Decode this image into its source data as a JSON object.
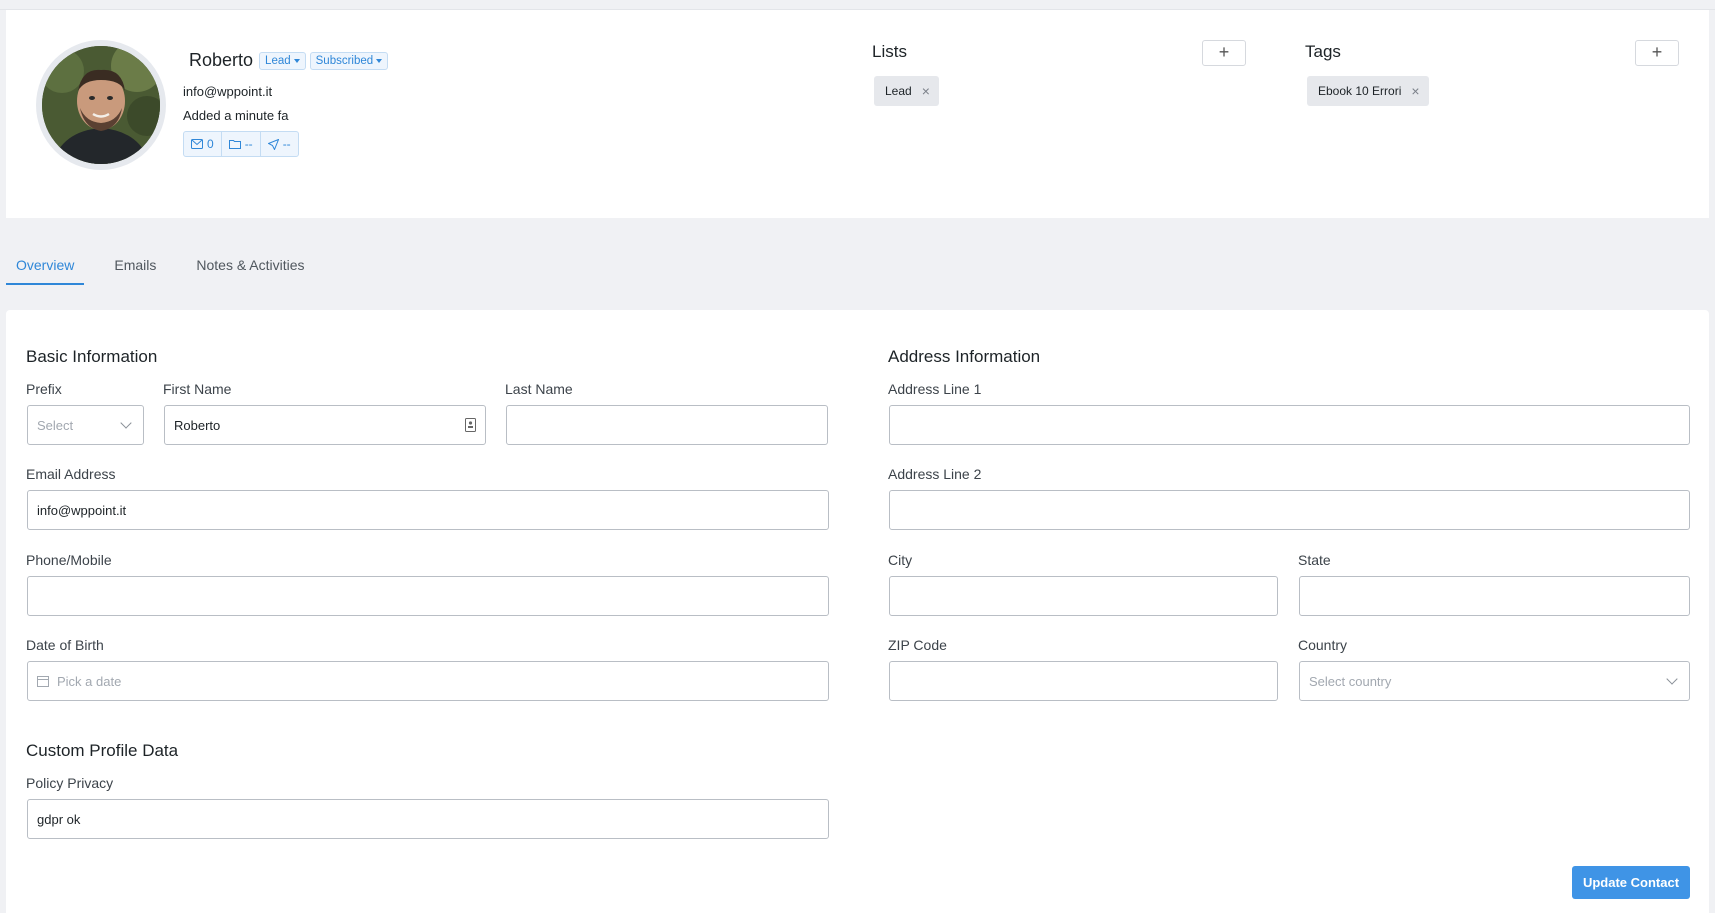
{
  "profile": {
    "name": "Roberto",
    "status_chips": [
      "Lead",
      "Subscribed"
    ],
    "email": "info@wppoint.it",
    "added": "Added a minute fa",
    "stats": {
      "emails": "0",
      "folder": "--",
      "sent": "--"
    }
  },
  "lists": {
    "title": "Lists",
    "add": "+",
    "items": [
      "Lead"
    ]
  },
  "tags": {
    "title": "Tags",
    "add": "+",
    "items": [
      "Ebook 10 Errori"
    ]
  },
  "tabs": [
    "Overview",
    "Emails",
    "Notes & Activities"
  ],
  "basic": {
    "title": "Basic Information",
    "prefix_label": "Prefix",
    "prefix_placeholder": "Select",
    "first_name_label": "First Name",
    "first_name_value": "Roberto",
    "last_name_label": "Last Name",
    "last_name_value": "",
    "email_label": "Email Address",
    "email_value": "info@wppoint.it",
    "phone_label": "Phone/Mobile",
    "phone_value": "",
    "dob_label": "Date of Birth",
    "dob_placeholder": "Pick a date"
  },
  "address": {
    "title": "Address Information",
    "line1_label": "Address Line 1",
    "line2_label": "Address Line 2",
    "city_label": "City",
    "state_label": "State",
    "zip_label": "ZIP Code",
    "country_label": "Country",
    "country_placeholder": "Select country"
  },
  "custom": {
    "title": "Custom Profile Data",
    "policy_label": "Policy Privacy",
    "policy_value": "gdpr ok"
  },
  "update_button": "Update Contact",
  "colors": {
    "accent": "#3f94e6",
    "link": "#2f87d8"
  }
}
